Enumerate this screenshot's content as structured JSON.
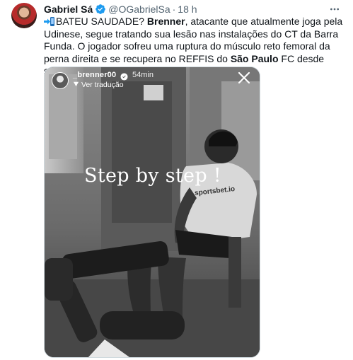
{
  "tweet": {
    "author_name": "Gabriel Sá",
    "handle": "@OGabrielSa",
    "separator": "·",
    "time": "18 h",
    "text": {
      "p1": "BATEU SAUDADE? ",
      "p2": "Brenner",
      "p3": ", atacante que atualmente joga pela Udinese, segue tratando sua lesão nas instalações do CT da Barra Funda. O jogador sofreu uma ruptura do músculo reto femoral da perna direita e se recupera no REFFIS do ",
      "p4": "São Paulo",
      "p5": " FC desde setembro."
    }
  },
  "story": {
    "username": "_brenner00",
    "time": "54min",
    "translate_label": "Ver tradução",
    "caption": "Step by step !",
    "shirt_text": "sportsbet.io"
  },
  "colors": {
    "verified": "#1d9bf0",
    "text_primary": "#0f1419",
    "text_secondary": "#536471",
    "border": "#cfd9de"
  },
  "icons": [
    "verified-badge-icon",
    "more-icon",
    "mobile-emoji-icon",
    "close-icon",
    "translate-icon"
  ]
}
